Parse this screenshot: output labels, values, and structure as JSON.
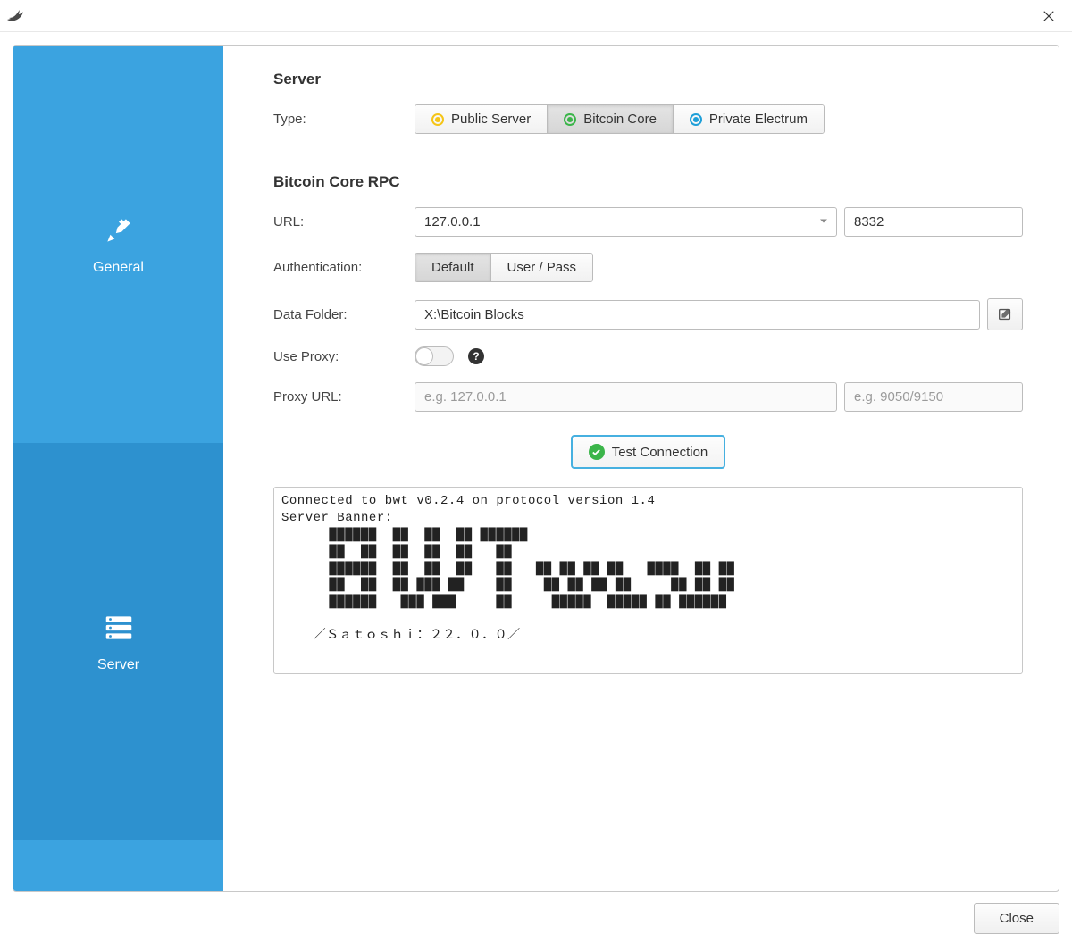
{
  "sidebar": {
    "items": [
      {
        "label": "General"
      },
      {
        "label": "Server"
      }
    ]
  },
  "sections": {
    "server_heading": "Server",
    "rpc_heading": "Bitcoin Core RPC"
  },
  "labels": {
    "type": "Type:",
    "url": "URL:",
    "auth": "Authentication:",
    "data_folder": "Data Folder:",
    "use_proxy": "Use Proxy:",
    "proxy_url": "Proxy URL:"
  },
  "type_options": {
    "public": "Public Server",
    "bitcoin_core": "Bitcoin Core",
    "private_electrum": "Private Electrum",
    "selected": "bitcoin_core"
  },
  "rpc": {
    "host": "127.0.0.1",
    "port": "8332"
  },
  "auth_options": {
    "default": "Default",
    "userpass": "User / Pass",
    "selected": "default"
  },
  "data_folder": "X:\\Bitcoin Blocks",
  "proxy": {
    "enabled": false,
    "host_placeholder": "e.g. 127.0.0.1",
    "port_placeholder": "e.g. 9050/9150"
  },
  "test_button": "Test Connection",
  "console_output": "Connected to bwt v0.2.4 on protocol version 1.4\nServer Banner:\n      ██████  ██  ██  ██ ██████\n      ██  ██  ██  ██  ██   ██\n      ██████  ██  ██  ██   ██   ██ ██ ██ ██   ████  ██ ██\n      ██  ██  ██ ███ ██    ██    ██ ██ ██ ██     ██ ██ ██\n      ██████   ███ ███     ██     █████  █████ ██ ██████\n\n    ／Ｓａｔｏｓｈｉ：２２．０．０／",
  "footer": {
    "close": "Close"
  }
}
